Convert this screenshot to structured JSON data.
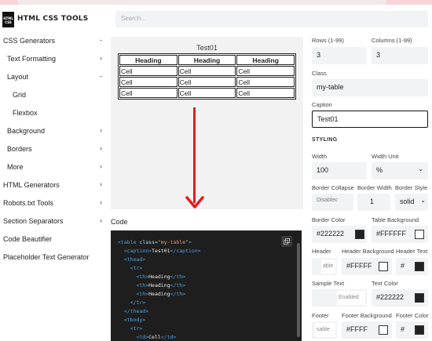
{
  "app": {
    "logo_text": "HTML CSS",
    "brand": "HTML CSS TOOLS"
  },
  "search": {
    "placeholder": "Search..."
  },
  "colors": {
    "accent_arrow": "#e11d1d",
    "code_bg": "#1e1e1e",
    "top_strip": "#f7d4d8"
  },
  "sidebar": {
    "items": [
      {
        "label": "CSS Generators",
        "chevron": "-"
      },
      {
        "label": "Text Formatting",
        "chevron": "›"
      },
      {
        "label": "Layout",
        "chevron": "-"
      },
      {
        "label": "Grid",
        "chevron": ""
      },
      {
        "label": "Flexbox",
        "chevron": ""
      },
      {
        "label": "Background",
        "chevron": "›"
      },
      {
        "label": "Borders",
        "chevron": "›"
      },
      {
        "label": "More",
        "chevron": "›"
      },
      {
        "label": "HTML Generators",
        "chevron": "›"
      },
      {
        "label": "Robots.txt Tools",
        "chevron": "›"
      },
      {
        "label": "Section Separators",
        "chevron": "›"
      },
      {
        "label": "Code Beautifier",
        "chevron": ""
      },
      {
        "label": "Placeholder Text Generator",
        "chevron": ""
      }
    ]
  },
  "preview": {
    "caption": "Test01",
    "headers": [
      "Heading",
      "Heading",
      "Heading"
    ],
    "rows": [
      [
        "Cell",
        "Cell",
        "Cell"
      ],
      [
        "Cell",
        "Cell",
        "Cell"
      ],
      [
        "Cell",
        "Cell",
        "Cell"
      ]
    ]
  },
  "code": {
    "title": "Code",
    "copy_icon": "copy-icon",
    "lines": [
      {
        "t1": "<table ",
        "a": "class=",
        "s": "\"my-table\"",
        "t2": ">"
      },
      {
        "t1": "  <caption>",
        "x": "Test01",
        "t2": "</caption>"
      },
      {
        "t1": "  <thead>"
      },
      {
        "t1": "    <tr>"
      },
      {
        "t1": "      <th>",
        "x": "Heading",
        "t2": "</th>"
      },
      {
        "t1": "      <th>",
        "x": "Heading",
        "t2": "</th>"
      },
      {
        "t1": "      <th>",
        "x": "Heading",
        "t2": "</th>"
      },
      {
        "t1": "    </tr>"
      },
      {
        "t1": "  </thead>"
      },
      {
        "t1": "  <tbody>"
      },
      {
        "t1": "    <tr>"
      },
      {
        "t1": "      <td>",
        "x": "Cell",
        "t2": "</td>"
      }
    ]
  },
  "settings": {
    "rows_label": "Rows (1-99)",
    "rows_value": "3",
    "cols_label": "Columns (1-99)",
    "cols_value": "3",
    "class_label": "Class",
    "class_value": "my-table",
    "caption_label": "Caption",
    "caption_value": "Test01",
    "styling_heading": "STYLING",
    "width_label": "Width",
    "width_value": "100",
    "width_unit_label": "Width Unit",
    "width_unit_value": "%",
    "border_collapse_label": "Border Collapse",
    "border_collapse_value": "Disablec",
    "border_width_label": "Border Width",
    "border_width_value": "1",
    "border_style_label": "Border Style",
    "border_style_value": "solid",
    "border_color_label": "Border Color",
    "border_color_value": "#222222",
    "table_bg_label": "Table Background",
    "table_bg_value": "#FFFFFF",
    "header_label": "Header",
    "header_value": "able",
    "header_bg_label": "Header Background",
    "header_bg_value": "#FFFFF",
    "header_text_label": "Header Text",
    "header_text_value": "#",
    "sample_text_label": "Sample Text",
    "sample_text_value": "Enabled",
    "text_color_label": "Text Color",
    "text_color_value": "#222222",
    "footer_label": "Footer",
    "footer_value": "sable",
    "footer_bg_label": "Footer Background",
    "footer_bg_value": "#FFFF",
    "footer_color_label": "Footer Color",
    "footer_color_value": "#"
  }
}
